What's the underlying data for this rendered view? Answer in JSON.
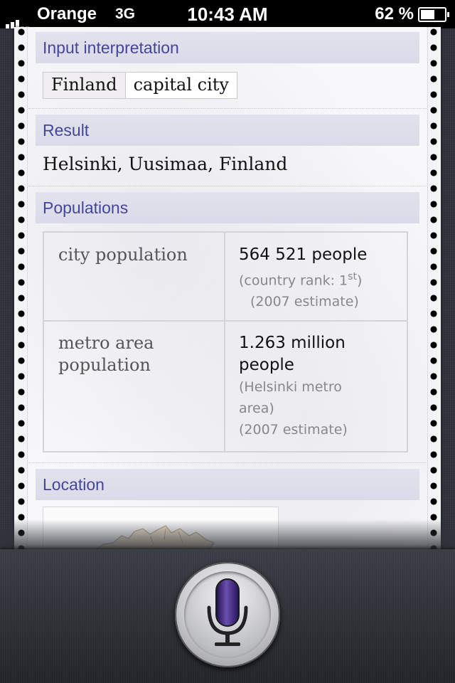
{
  "status_bar": {
    "carrier": "Orange",
    "network": "3G",
    "time": "10:43 AM",
    "battery_percent": "62 %",
    "battery_level": 0.62,
    "signal_bars": 3
  },
  "pods": {
    "input": {
      "title": "Input interpretation",
      "chips": [
        "Finland",
        "capital city"
      ]
    },
    "result": {
      "title": "Result",
      "text": "Helsinki, Uusimaa, Finland"
    },
    "populations": {
      "title": "Populations",
      "rows": [
        {
          "label": "city population",
          "value": "564 521 people",
          "rank_prefix": "(country rank: 1",
          "rank_sup": "st",
          "rank_suffix": ")",
          "note": "(2007 estimate)"
        },
        {
          "label_line1": "metro area",
          "label_line2": "population",
          "value_line1": "1.263 million",
          "value_line2": "people",
          "note1": "(Helsinki metro",
          "note2": "area)",
          "note3": "(2007 estimate)"
        }
      ]
    },
    "location": {
      "title": "Location"
    }
  },
  "siri": {
    "mic_icon": "microphone-icon",
    "accent_color": "#3b1f7a"
  }
}
